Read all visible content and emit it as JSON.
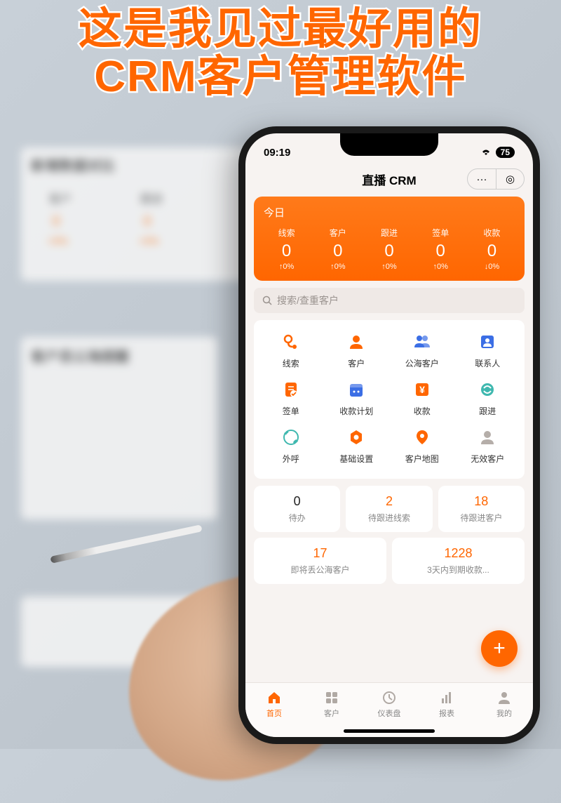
{
  "caption_line1": "这是我见过最好用的",
  "caption_line2": "CRM客户管理软件",
  "bg": {
    "card1_title": "新增数据对比",
    "label_cust": "客户",
    "label_follow": "跟进",
    "zero": "0",
    "pct": "+0%",
    "card2_title": "客户丢公海提醒"
  },
  "status": {
    "time": "09:19",
    "battery": "75"
  },
  "nav": {
    "title": "直播 CRM",
    "more": "···",
    "target": "◎"
  },
  "metrics": {
    "date": "今日",
    "items": [
      {
        "label": "线索",
        "value": "0",
        "delta": "↑0%"
      },
      {
        "label": "客户",
        "value": "0",
        "delta": "↑0%"
      },
      {
        "label": "跟进",
        "value": "0",
        "delta": "↑0%"
      },
      {
        "label": "签单",
        "value": "0",
        "delta": "↑0%"
      },
      {
        "label": "收款",
        "value": "0",
        "delta": "↓0%"
      }
    ]
  },
  "search": {
    "placeholder": "搜索/查重客户"
  },
  "grid": [
    {
      "label": "线索",
      "color": "#ff6600",
      "icon": "leads"
    },
    {
      "label": "客户",
      "color": "#ff6600",
      "icon": "customer"
    },
    {
      "label": "公海客户",
      "color": "#3b6ee5",
      "icon": "pool"
    },
    {
      "label": "联系人",
      "color": "#3b6ee5",
      "icon": "contact"
    },
    {
      "label": "签单",
      "color": "#ff6600",
      "icon": "sign"
    },
    {
      "label": "收款计划",
      "color": "#3b6ee5",
      "icon": "plan"
    },
    {
      "label": "收款",
      "color": "#ff6600",
      "icon": "payment"
    },
    {
      "label": "跟进",
      "color": "#3fb8af",
      "icon": "follow"
    },
    {
      "label": "外呼",
      "color": "#3fb8af",
      "icon": "call"
    },
    {
      "label": "基础设置",
      "color": "#ff6600",
      "icon": "settings"
    },
    {
      "label": "客户地图",
      "color": "#ff6600",
      "icon": "map"
    },
    {
      "label": "无效客户",
      "color": "#b5aea9",
      "icon": "invalid"
    }
  ],
  "stats": [
    {
      "value": "0",
      "label": "待办",
      "color": "black"
    },
    {
      "value": "2",
      "label": "待跟进线索",
      "color": "orange"
    },
    {
      "value": "18",
      "label": "待跟进客户",
      "color": "orange"
    },
    {
      "value": "17",
      "label": "即将丢公海客户",
      "color": "orange"
    },
    {
      "value": "1228",
      "label": "3天内到期收款...",
      "color": "orange"
    }
  ],
  "fab": "+",
  "tabs": [
    {
      "label": "首页",
      "active": true
    },
    {
      "label": "客户",
      "active": false
    },
    {
      "label": "仪表盘",
      "active": false
    },
    {
      "label": "报表",
      "active": false
    },
    {
      "label": "我的",
      "active": false
    }
  ]
}
